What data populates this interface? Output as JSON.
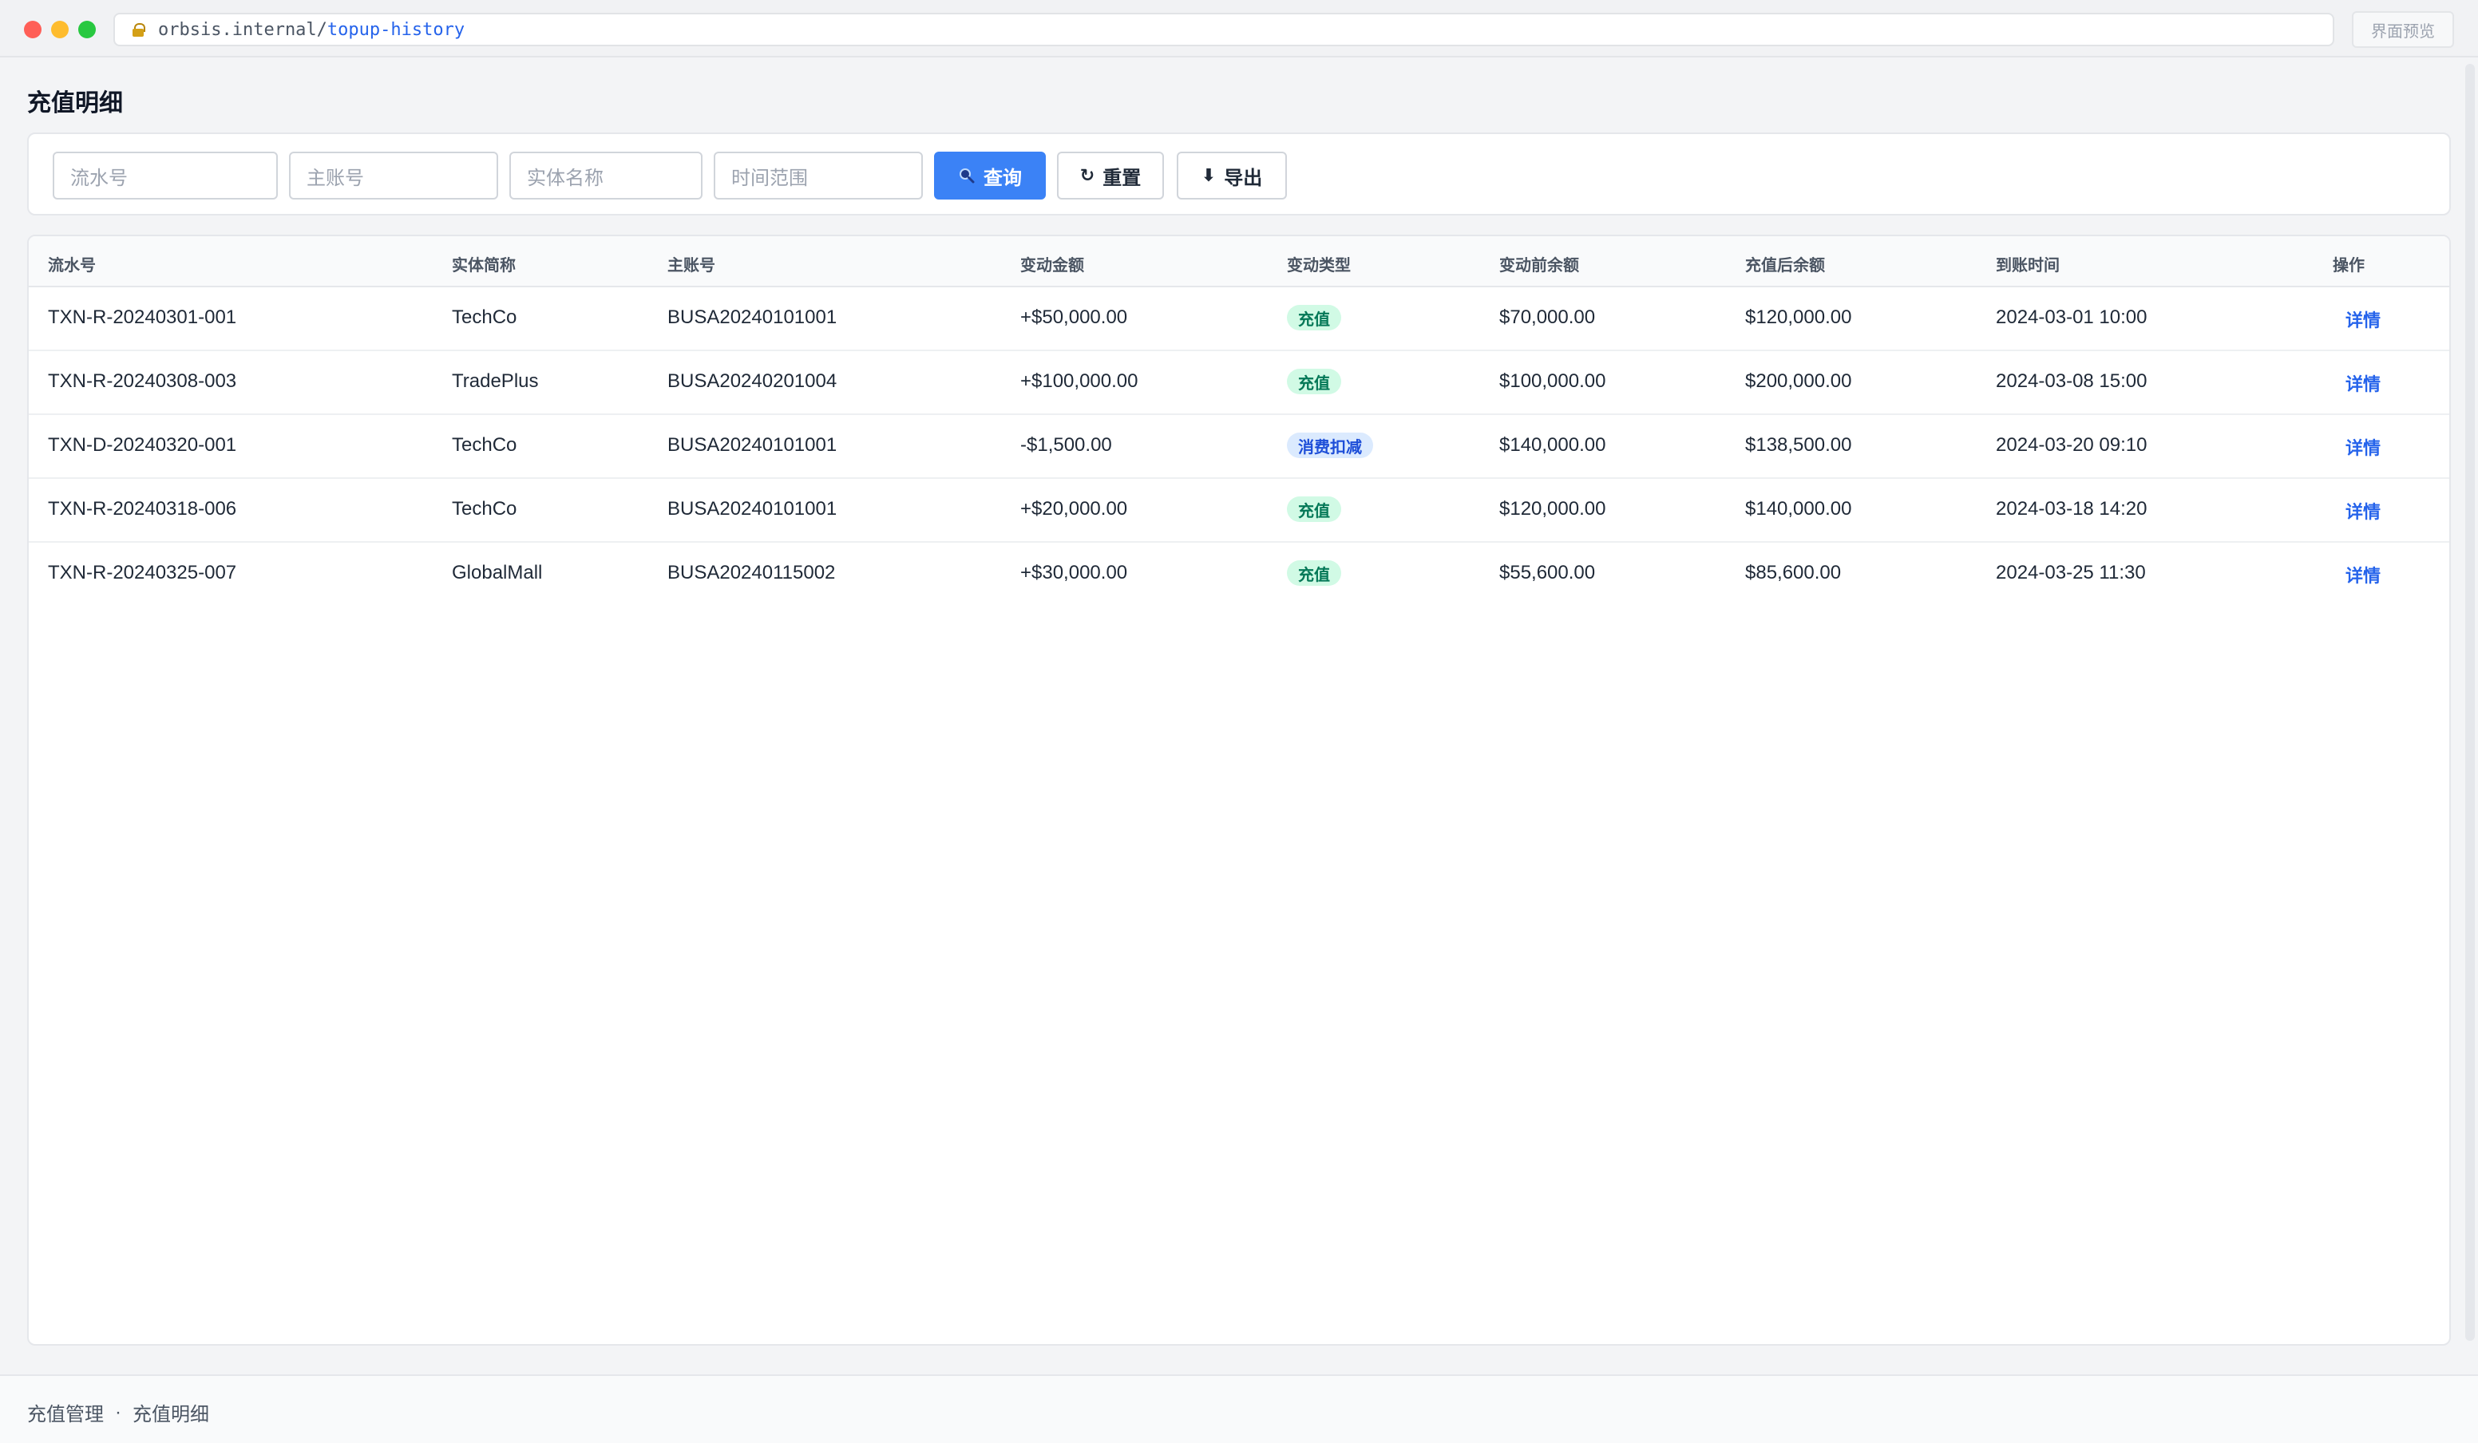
{
  "browser": {
    "url_host": "orbsis.internal/",
    "url_path": "topup-history",
    "preview_label": "界面预览"
  },
  "page": {
    "title": "充值明细"
  },
  "filters": {
    "serial_placeholder": "流水号",
    "account_placeholder": "主账号",
    "entity_placeholder": "实体名称",
    "time_placeholder": "时间范围",
    "query_label": "查询",
    "reset_label": "重置",
    "export_label": "导出"
  },
  "table": {
    "headers": [
      "流水号",
      "实体简称",
      "主账号",
      "变动金额",
      "变动类型",
      "变动前余额",
      "充值后余额",
      "到账时间",
      "操作"
    ],
    "rows": [
      {
        "serial": "TXN-R-20240301-001",
        "entity": "TechCo",
        "account": "BUSA20240101001",
        "amount": "+$50,000.00",
        "type": "充值",
        "before": "$70,000.00",
        "after": "$120,000.00",
        "time": "2024-03-01 10:00",
        "action": "详情"
      },
      {
        "serial": "TXN-R-20240308-003",
        "entity": "TradePlus",
        "account": "BUSA20240201004",
        "amount": "+$100,000.00",
        "type": "充值",
        "before": "$100,000.00",
        "after": "$200,000.00",
        "time": "2024-03-08 15:00",
        "action": "详情"
      },
      {
        "serial": "TXN-D-20240320-001",
        "entity": "TechCo",
        "account": "BUSA20240101001",
        "amount": "-$1,500.00",
        "type": "消费扣减",
        "before": "$140,000.00",
        "after": "$138,500.00",
        "time": "2024-03-20 09:10",
        "action": "详情"
      },
      {
        "serial": "TXN-R-20240318-006",
        "entity": "TechCo",
        "account": "BUSA20240101001",
        "amount": "+$20,000.00",
        "type": "充值",
        "before": "$120,000.00",
        "after": "$140,000.00",
        "time": "2024-03-18 14:20",
        "action": "详情"
      },
      {
        "serial": "TXN-R-20240325-007",
        "entity": "GlobalMall",
        "account": "BUSA20240115002",
        "amount": "+$30,000.00",
        "type": "充值",
        "before": "$55,600.00",
        "after": "$85,600.00",
        "time": "2024-03-25 11:30",
        "action": "详情"
      }
    ]
  },
  "footer": {
    "crumb_parent": "充值管理",
    "crumb_sep": "·",
    "crumb_current": "充值明细"
  },
  "colors": {
    "primary": "#3b82f6",
    "badge_topup_bg": "#d1fae5",
    "badge_topup_text": "#047857",
    "badge_deduct_bg": "#dbeafe",
    "badge_deduct_text": "#1d4ed8",
    "link": "#2563eb"
  },
  "icons": {
    "query": "search-icon",
    "reset": "refresh-icon",
    "export": "download-icon",
    "lock": "lock-icon"
  }
}
